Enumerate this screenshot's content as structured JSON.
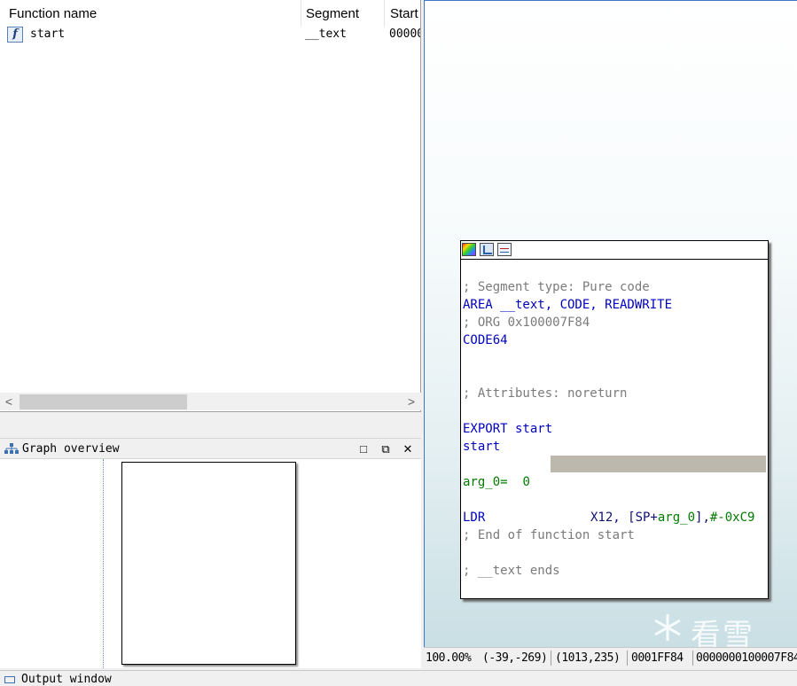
{
  "functions": {
    "columns": [
      "Function name",
      "Segment",
      "Start"
    ],
    "rows": [
      {
        "icon": "function-icon",
        "glyph": "f",
        "name": "start",
        "segment": "__text",
        "start": "00000"
      }
    ],
    "scroll_left": "<",
    "scroll_right": ">"
  },
  "graph_overview": {
    "title": "Graph overview",
    "buttons": {
      "maximize": "□",
      "restore": "⧉",
      "close": "✕"
    }
  },
  "output_window": {
    "title": "Output window"
  },
  "disasm": {
    "lines": [
      {
        "text": "; Segment type: Pure code",
        "kind": "comment"
      },
      {
        "text": "AREA __text, CODE, READWRITE",
        "kind": "keyword"
      },
      {
        "text": "; ORG 0x100007F84",
        "kind": "comment"
      },
      {
        "text": "CODE64",
        "kind": "keyword"
      },
      {
        "text": "; Attributes: noreturn",
        "kind": "comment"
      },
      {
        "text": "EXPORT start",
        "kind": "keyword"
      },
      {
        "text": "start",
        "kind": "keyword"
      },
      {
        "text_a": "arg_0=  ",
        "text_b": "0",
        "kind": "green"
      },
      {
        "mnem": "LDR",
        "op_reg": "X12, [SP+",
        "op_var": "arg_0",
        "op_imm_pre": "],",
        "op_imm": "#-0xC9",
        "kind": "insn"
      },
      {
        "text": "; End of function start",
        "kind": "comment"
      },
      {
        "text": "; __text ends",
        "kind": "comment"
      }
    ]
  },
  "watermark": "看雪",
  "status_bar": {
    "zoom": "100.00%",
    "mouse": "(-39,-269)",
    "graph_pos": "(1013,235)",
    "offset": "0001FF84",
    "address": "0000000100007F84"
  },
  "colors": {
    "comment": "#7b7b7b",
    "keyword": "#0000c0",
    "number": "#007a00",
    "highlight": "#bcb8ad",
    "border_blue": "#3b79c4"
  }
}
